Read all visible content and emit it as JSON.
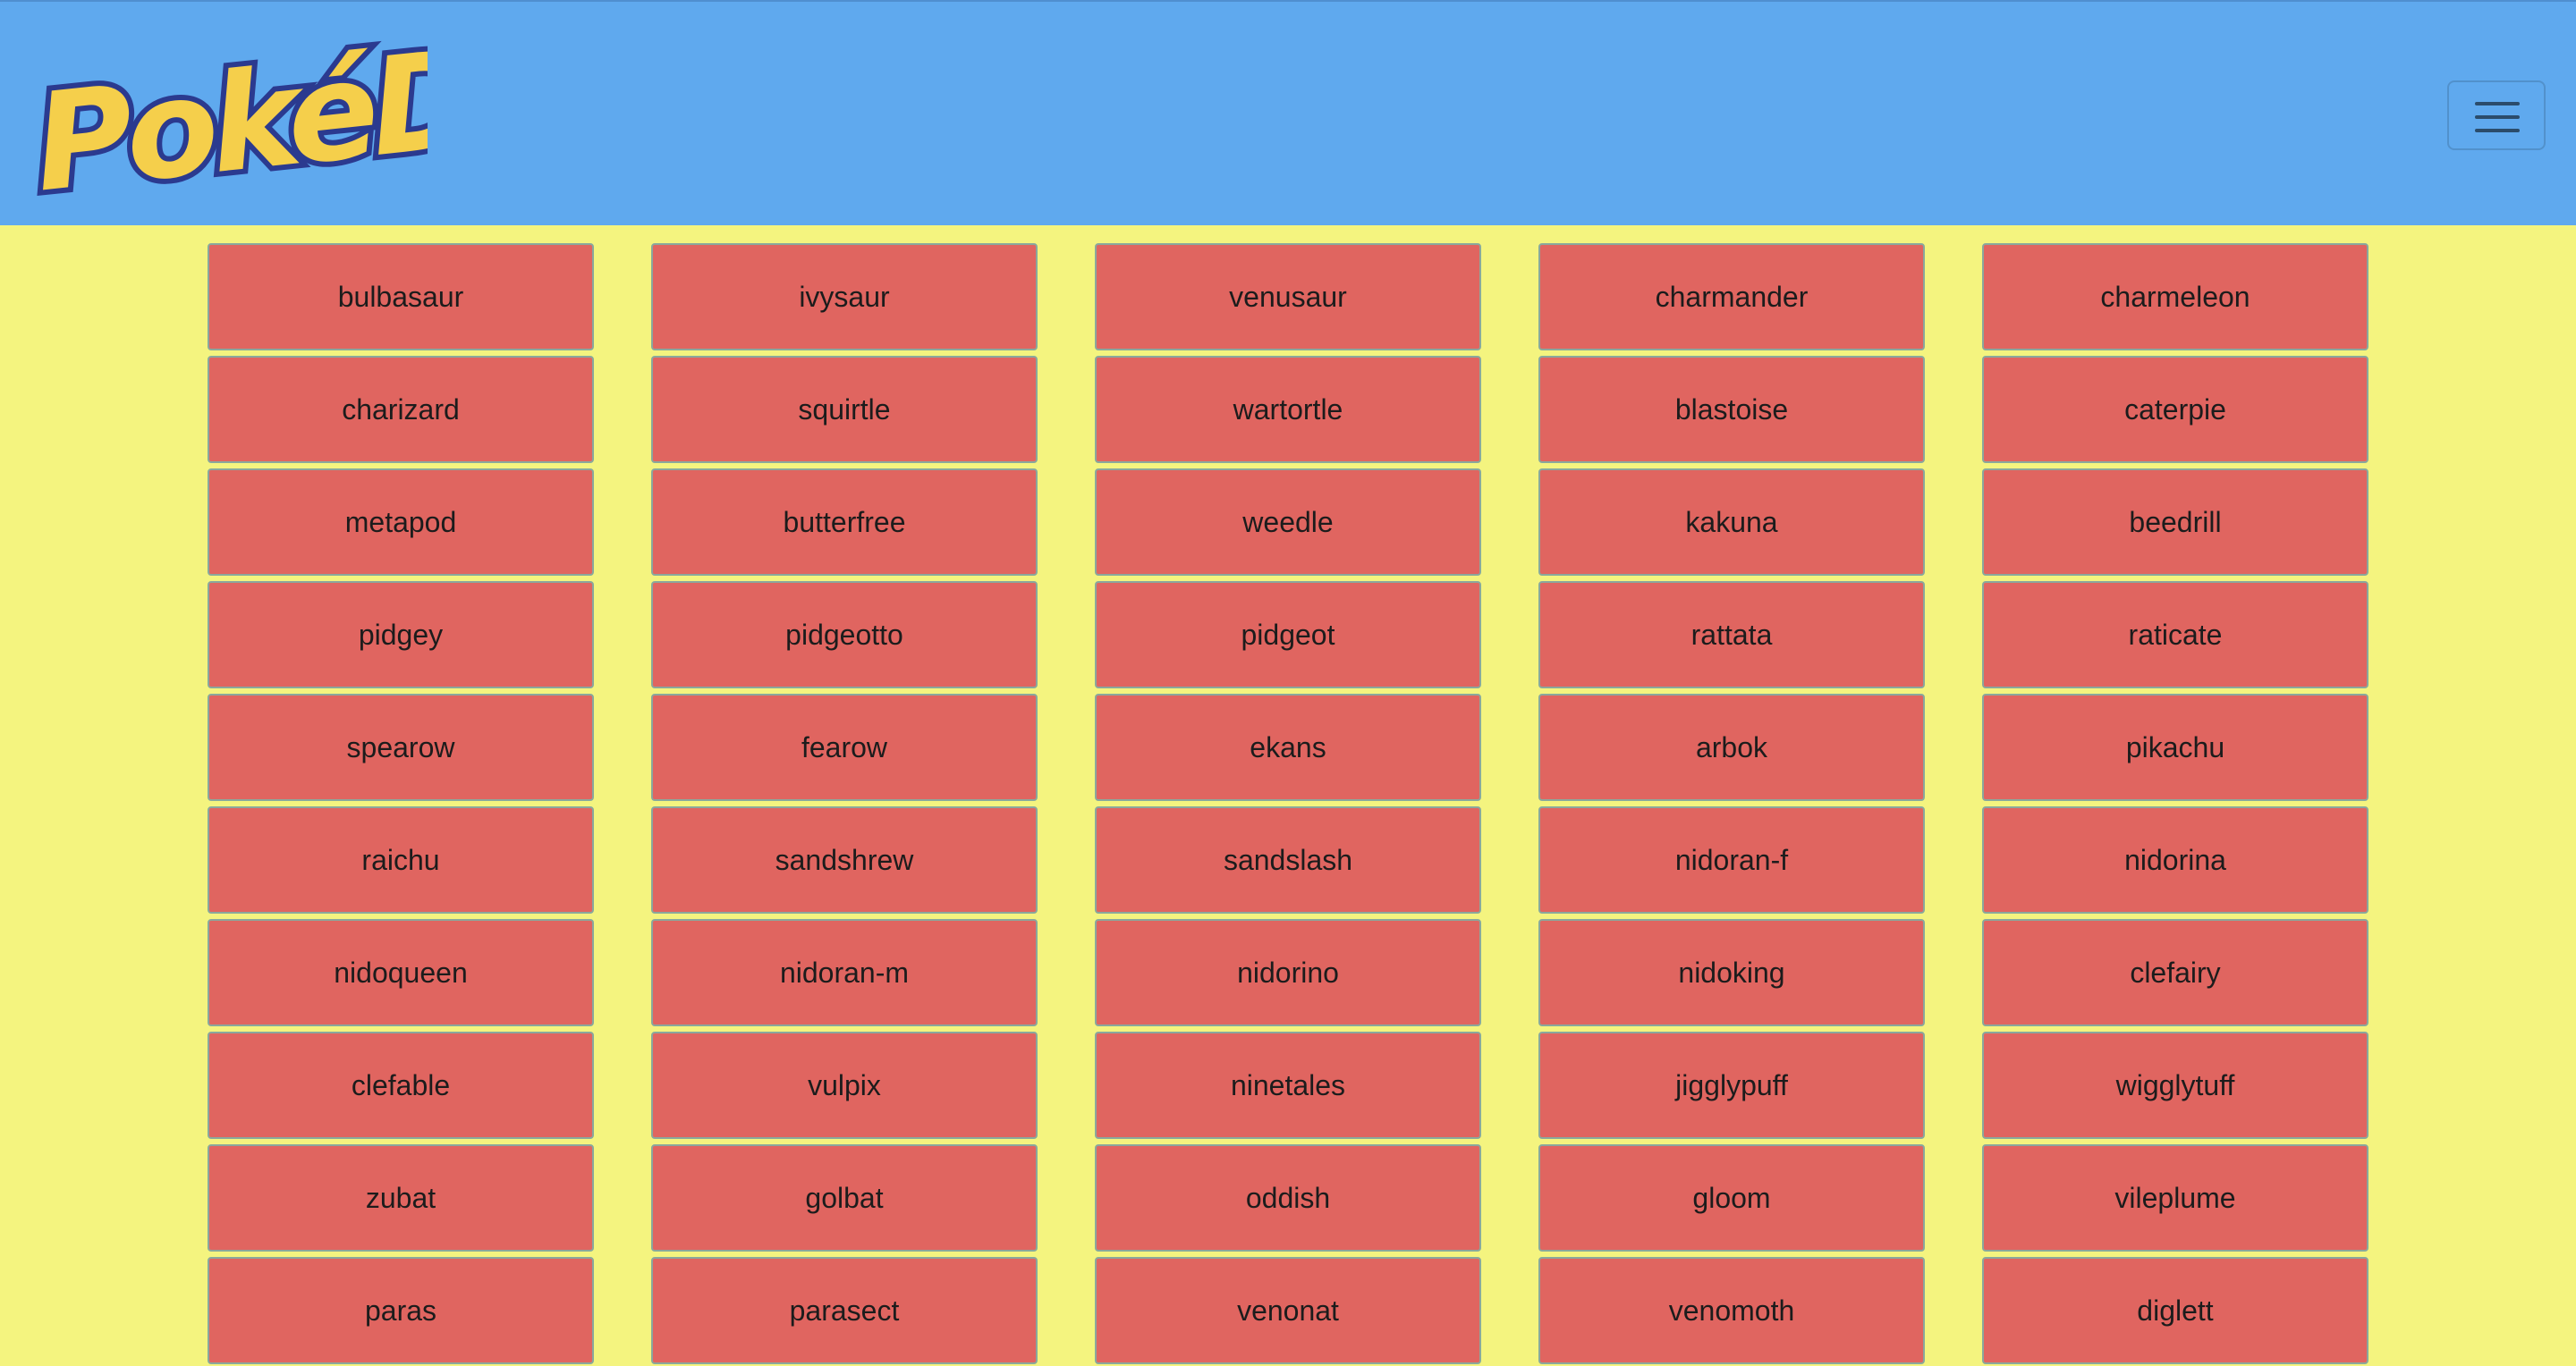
{
  "header": {
    "logo_text": "PokéDex",
    "menu_icon": "hamburger-menu-icon"
  },
  "colors": {
    "navbar_bg": "#5fa9ee",
    "page_bg": "#f4f47f",
    "card_bg": "#e06560",
    "card_border": "#8aa89c",
    "logo_fill": "#f5cf4b",
    "logo_outline": "#2b3a8f"
  },
  "pokemon": [
    "bulbasaur",
    "ivysaur",
    "venusaur",
    "charmander",
    "charmeleon",
    "charizard",
    "squirtle",
    "wartortle",
    "blastoise",
    "caterpie",
    "metapod",
    "butterfree",
    "weedle",
    "kakuna",
    "beedrill",
    "pidgey",
    "pidgeotto",
    "pidgeot",
    "rattata",
    "raticate",
    "spearow",
    "fearow",
    "ekans",
    "arbok",
    "pikachu",
    "raichu",
    "sandshrew",
    "sandslash",
    "nidoran-f",
    "nidorina",
    "nidoqueen",
    "nidoran-m",
    "nidorino",
    "nidoking",
    "clefairy",
    "clefable",
    "vulpix",
    "ninetales",
    "jigglypuff",
    "wigglytuff",
    "zubat",
    "golbat",
    "oddish",
    "gloom",
    "vileplume",
    "paras",
    "parasect",
    "venonat",
    "venomoth",
    "diglett"
  ]
}
